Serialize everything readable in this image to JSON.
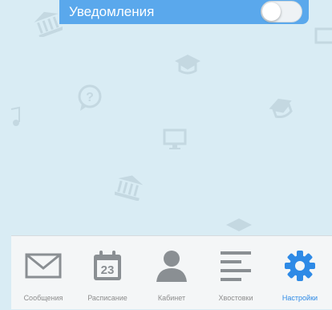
{
  "settings": {
    "notifications_label": "Уведомления",
    "notifications_enabled": false
  },
  "calendar_icon_day": "23",
  "tabs": [
    {
      "label": "Сообщения",
      "icon": "envelope-icon"
    },
    {
      "label": "Расписание",
      "icon": "calendar-icon"
    },
    {
      "label": "Кабинет",
      "icon": "user-icon"
    },
    {
      "label": "Хвостовки",
      "icon": "list-icon"
    },
    {
      "label": "Настройки",
      "icon": "gear-icon",
      "active": true
    }
  ],
  "colors": {
    "accent": "#2e8ae6",
    "header_bar": "#5aa8ec",
    "background": "#d9ecf4",
    "tab_icon": "#8a8f93"
  }
}
